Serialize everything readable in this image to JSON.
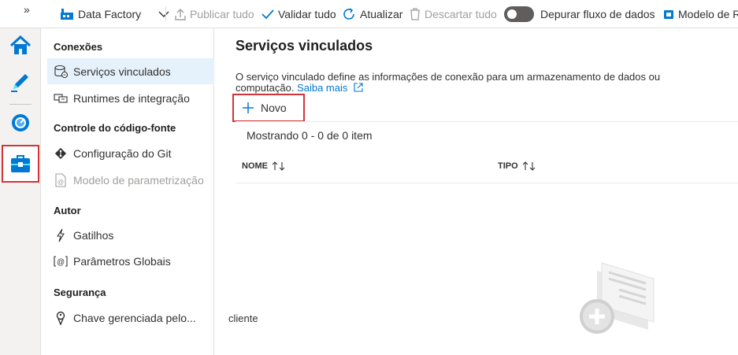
{
  "topbar": {
    "expand_glyph": "»",
    "factory_label": "Data Factory",
    "publish_label": "Publicar tudo",
    "validate_label": "Validar tudo",
    "refresh_label": "Atualizar",
    "discard_label": "Descartar tudo",
    "debug_label": "Depurar fluxo de dados",
    "template_label": "Modelo de R"
  },
  "rail": {
    "items": [
      {
        "icon": "home-icon"
      },
      {
        "icon": "pencil-icon"
      },
      {
        "icon": "monitor-icon"
      },
      {
        "icon": "toolbox-icon",
        "selected": true
      }
    ]
  },
  "nav": {
    "sections": [
      {
        "header": "Conexões",
        "items": [
          {
            "label": "Serviços vinculados",
            "icon": "linked-service-icon",
            "active": true
          },
          {
            "label": "Runtimes de integração",
            "icon": "integration-runtime-icon"
          }
        ]
      },
      {
        "header": "Controle do código-fonte",
        "items": [
          {
            "label": "Configuração do Git",
            "icon": "git-icon"
          },
          {
            "label": "Modelo de parametrização",
            "icon": "parameter-template-icon",
            "disabled": true
          }
        ]
      },
      {
        "header": "Autor",
        "items": [
          {
            "label": "Gatilhos",
            "icon": "trigger-icon"
          },
          {
            "label": "Parâmetros Globais",
            "icon": "global-parameters-icon"
          }
        ]
      },
      {
        "header": "Segurança",
        "items": [
          {
            "label": "Chave gerenciada pelo...",
            "icon": "key-icon"
          }
        ]
      }
    ]
  },
  "main": {
    "title": "Serviços vinculados",
    "description": "O serviço vinculado define as informações de conexão para um armazenamento de dados ou computação.",
    "learn_more": "Saiba mais",
    "new_button": "Novo",
    "count_text": "Mostrando 0 - 0 de 0 item",
    "columns": [
      "NOME",
      "TIPO"
    ],
    "stray_text": "cliente"
  },
  "colors": {
    "accent": "#0078d4",
    "highlight": "#d13438",
    "active_nav": "#e5f1fb"
  }
}
